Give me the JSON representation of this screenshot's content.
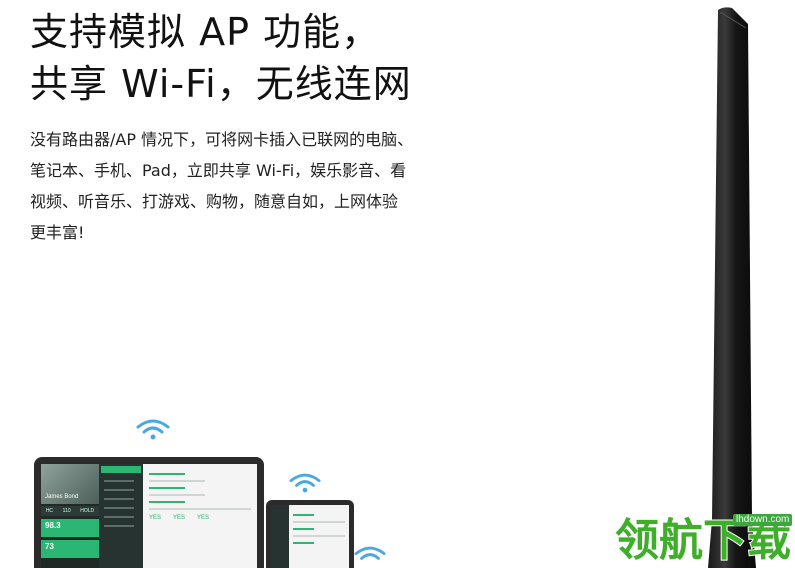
{
  "headline": {
    "line1": "支持模拟 AP 功能，",
    "line2": "共享 Wi-Fi，无线连网"
  },
  "body": {
    "lines": [
      "没有路由器/AP 情况下，可将网卡插入已联网的电脑、",
      "笔记本、手机、Pad，立即共享 Wi-Fi，娱乐影音、看",
      "视频、听音乐、打游戏、购物，随意自如，上网体验",
      "更丰富!"
    ]
  },
  "laptop_screen": {
    "name": "James Bond",
    "stats": [
      "HC",
      "110",
      "HOLD"
    ],
    "tile1": "98.3",
    "tile2": "73",
    "values": [
      "YES",
      "YES",
      "YES"
    ]
  },
  "watermark": {
    "text": "领航下载",
    "url": "lhdown.com"
  },
  "icons": {
    "wifi": "wifi-icon",
    "antenna": "antenna-image"
  },
  "colors": {
    "accent_green": "#2bb673",
    "wifi_blue": "#4aa8e0",
    "watermark_green": "#3fae2a"
  }
}
